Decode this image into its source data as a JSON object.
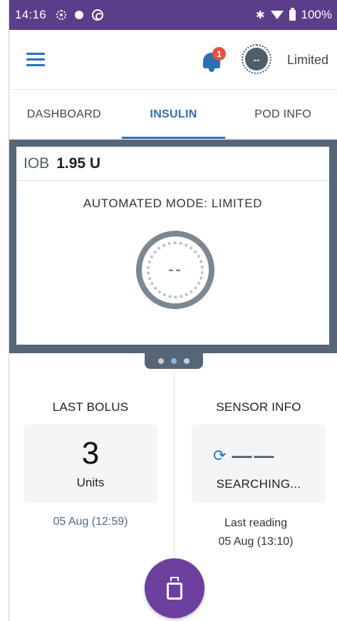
{
  "status_bar": {
    "time": "14:16",
    "battery": "100%",
    "icons": [
      "sun-icon",
      "dot-icon",
      "sync-swirl-icon",
      "bluetooth-icon",
      "wifi-icon",
      "battery-icon"
    ]
  },
  "app_bar": {
    "notification_count": "1",
    "status_gauge_text": "--",
    "status_label": "Limited"
  },
  "tabs": [
    {
      "label": "DASHBOARD",
      "active": false
    },
    {
      "label": "INSULIN",
      "active": true
    },
    {
      "label": "POD INFO",
      "active": false
    }
  ],
  "insulin_card": {
    "iob_label": "IOB",
    "iob_value": "1.95 U",
    "mode_text": "AUTOMATED MODE: LIMITED",
    "gauge_text": "--"
  },
  "pager": {
    "count": 3,
    "active_index": 1
  },
  "last_bolus": {
    "title": "LAST BOLUS",
    "value": "3",
    "unit": "Units",
    "date": "05 Aug (12:59)"
  },
  "sensor_info": {
    "title": "SENSOR INFO",
    "dashes": "——",
    "status": "SEARCHING...",
    "last_reading_label": "Last reading",
    "last_reading_date": "05 Aug (13:10)"
  },
  "colors": {
    "status_bar": "#5a3e8a",
    "accent": "#2d6fb5",
    "card_frame": "#566678",
    "fab": "#6d3f9e",
    "badge": "#e8523c"
  }
}
